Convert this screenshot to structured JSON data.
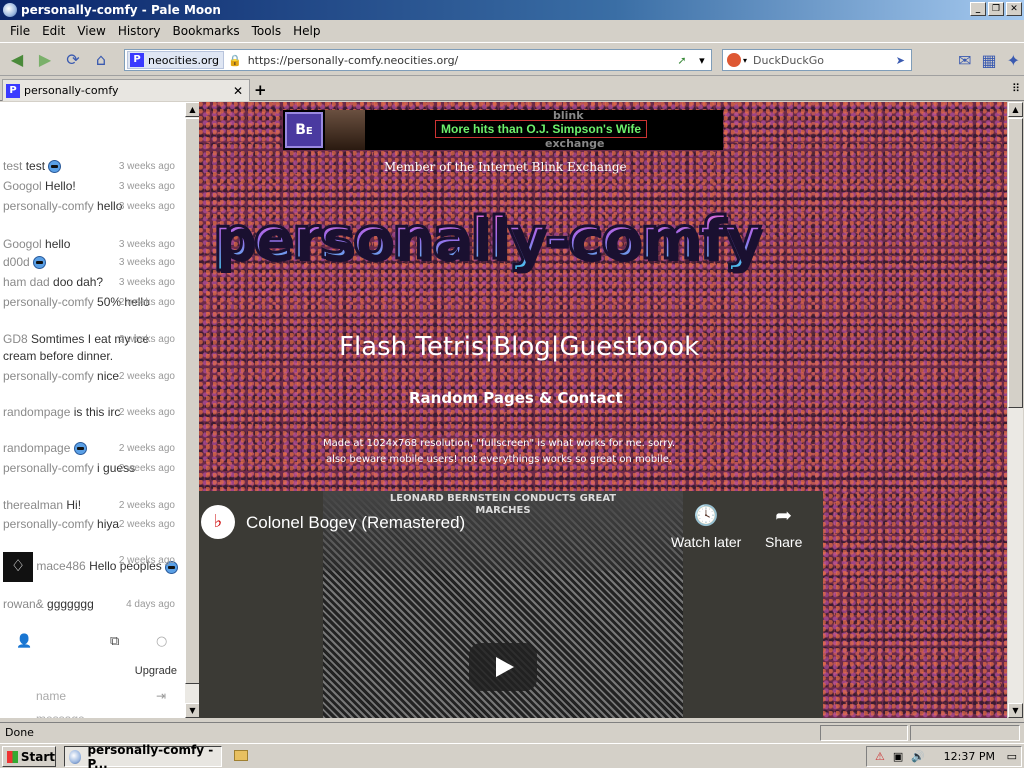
{
  "window": {
    "title": "personally-comfy - Pale Moon",
    "buttons": {
      "minimize": "_",
      "maximize": "❐",
      "close": "✕"
    }
  },
  "menu": [
    "File",
    "Edit",
    "View",
    "History",
    "Bookmarks",
    "Tools",
    "Help"
  ],
  "nav": {
    "identity": "neocities.org",
    "url": "https://personally-comfy.neocities.org/",
    "search_placeholder": "DuckDuckGo"
  },
  "tab": {
    "title": "personally-comfy",
    "close": "✕",
    "new": "+"
  },
  "chat": {
    "messages": [
      {
        "nick": "test",
        "text": "test",
        "time": "3 weeks ago",
        "emoji": true
      },
      {
        "nick": "Googol",
        "text": "Hello!",
        "time": "3 weeks ago"
      },
      {
        "nick": "personally-comfy",
        "text": "hello",
        "time": "3 weeks ago"
      },
      {
        "nick": "Googol",
        "text": "hello",
        "time": "3 weeks ago"
      },
      {
        "nick": "d00d",
        "text": "",
        "time": "3 weeks ago",
        "emoji": true
      },
      {
        "nick": "ham dad",
        "text": "doo dah?",
        "time": "3 weeks ago"
      },
      {
        "nick": "personally-comfy",
        "text": "50% hello",
        "time": "2 weeks ago"
      },
      {
        "nick": "GD8",
        "text": "Somtimes I eat my ice cream before dinner.",
        "time": "2 weeks ago"
      },
      {
        "nick": "personally-comfy",
        "text": "nice",
        "time": "2 weeks ago"
      },
      {
        "nick": "randompage",
        "text": "is this irc",
        "time": "2 weeks ago"
      },
      {
        "nick": "randompage",
        "text": "",
        "time": "2 weeks ago",
        "emoji": true
      },
      {
        "nick": "personally-comfy",
        "text": "i guess",
        "time": "2 weeks ago"
      },
      {
        "nick": "therealman",
        "text": "Hi!",
        "time": "2 weeks ago"
      },
      {
        "nick": "personally-comfy",
        "text": "hiya",
        "time": "2 weeks ago"
      },
      {
        "nick": "mace486",
        "text": "Hello peoples",
        "time": "2 weeks ago",
        "emoji": true
      },
      {
        "nick": "rowan&",
        "text": "ggggggg",
        "time": "4 days ago"
      }
    ],
    "upgrade": "Upgrade",
    "name_placeholder": "name",
    "message_placeholder": "message"
  },
  "page": {
    "banner_top": "blink",
    "banner_bottom": "exchange",
    "banner_ad": "More hits than O.J. Simpson's Wife",
    "member": "Member of the Internet Blink Exchange",
    "site_title": "personally-comfy",
    "nav_links": "Flash Tetris|Blog|Guestbook",
    "random": "Random Pages & Contact",
    "note_line1": "Made at 1024x768 resolution, \"fullscreen\" is what works for me. sorry.",
    "note_line2": "also beware mobile users! not everythings works so great on mobile."
  },
  "video": {
    "title": "Colonel Bogey (Remastered)",
    "watch_later": "Watch later",
    "share": "Share",
    "album_text": "LEONARD BERNSTEIN CONDUCTS GREAT MARCHES"
  },
  "status": {
    "text": "Done"
  },
  "taskbar": {
    "start": "Start",
    "item": "personally-comfy - P...",
    "clock": "12:37 PM"
  }
}
